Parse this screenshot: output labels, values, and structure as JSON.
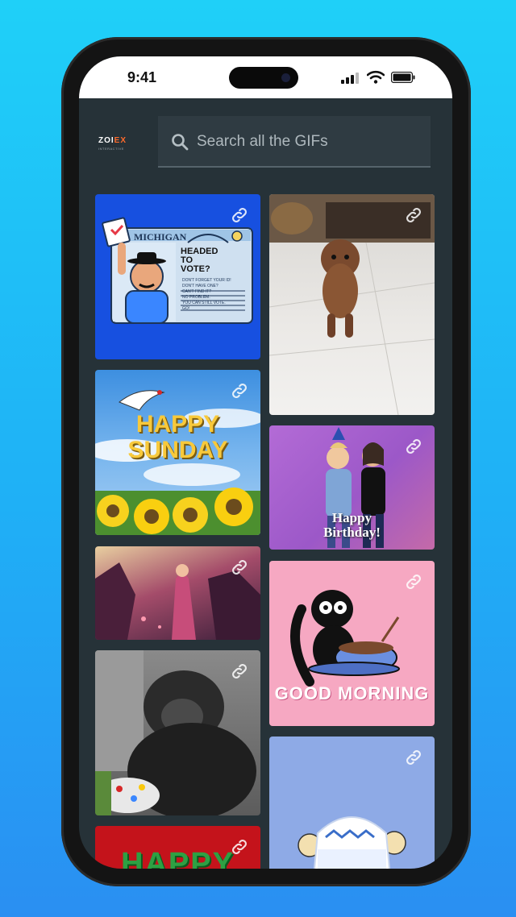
{
  "status_bar": {
    "time": "9:41"
  },
  "brand": {
    "name_left": "ZOI",
    "name_right": "EX",
    "tagline": "INTERACTIVE"
  },
  "search": {
    "placeholder": "Search all the GIFs"
  },
  "gifs": {
    "vote": {
      "state": "MICHIGAN",
      "line1": "HEADED",
      "line2": "TO",
      "line3": "VOTE?",
      "fine1": "DON'T FORGET YOUR ID!",
      "fine2": "DON'T HAVE ONE?",
      "fine3": "CAN'T FIND IT?",
      "fine4": "NO PROBLEM.",
      "fine5": "YOU CAN STILL VOTE.",
      "fine6": "GO!"
    },
    "sunday": {
      "line1": "HAPPY",
      "line2": "SUNDAY"
    },
    "birthday": {
      "line1": "Happy",
      "line2": "Birthday!"
    },
    "morning": {
      "caption": "GOOD MORNING"
    },
    "happy_partial": {
      "caption": "HAPPY"
    }
  }
}
